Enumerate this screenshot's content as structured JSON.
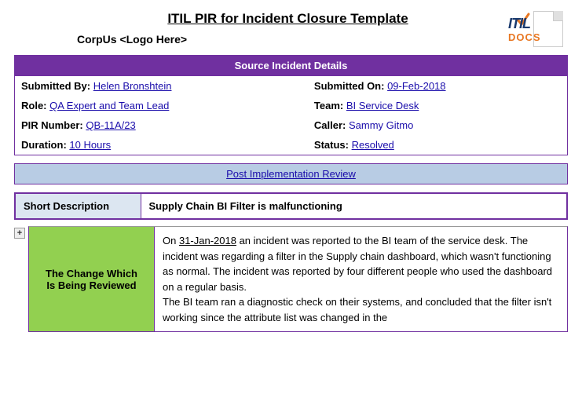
{
  "page": {
    "title": "ITIL PIR for Incident Closure Template",
    "corp_logo": "CorpUs <Logo Here>",
    "logo": {
      "itil": "ITIL",
      "docs": "DOCS"
    },
    "source_banner": "Source Incident Details",
    "pir_banner": "Post Implementation Review",
    "fields": {
      "submitted_by_label": "Submitted By:",
      "submitted_by_value": "Helen Bronshtein",
      "submitted_on_label": "Submitted On:",
      "submitted_on_value": "09-Feb-2018",
      "role_label": "Role:",
      "role_value": "QA Expert and Team Lead",
      "team_label": "Team:",
      "team_value": "BI Service Desk",
      "pir_number_label": "PIR Number:",
      "pir_number_value": "QB-11A/23",
      "caller_label": "Caller:",
      "caller_value": "Sammy Gitmo",
      "duration_label": "Duration:",
      "duration_value": "10 Hours",
      "status_label": "Status:",
      "status_value": "Resolved"
    },
    "short_description": {
      "label": "Short Description",
      "value": "Supply Chain BI Filter is malfunctioning"
    },
    "change_section": {
      "label": "The Change Which\nIs Being Reviewed",
      "date_underline": "31-Jan-2018",
      "content_pre": "On ",
      "content_post": " an incident was reported to the BI team of the service desk. The incident was regarding a filter in the Supply chain dashboard, which wasn't functioning as normal. The incident was reported by four different people who used the dashboard on a regular basis.\nThe BI team ran a diagnostic check on their systems, and concluded that the filter isn't working since the attribute list was changed in the"
    }
  }
}
